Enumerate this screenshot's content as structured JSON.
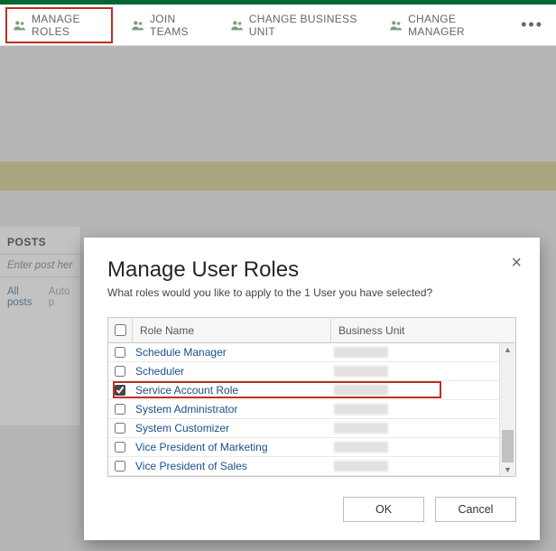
{
  "toolbar": {
    "items": [
      {
        "label": "MANAGE ROLES",
        "highlight": true
      },
      {
        "label": "JOIN TEAMS"
      },
      {
        "label": "CHANGE BUSINESS UNIT"
      },
      {
        "label": "CHANGE MANAGER"
      }
    ]
  },
  "side": {
    "heading": "POSTS",
    "placeholder": "Enter post here",
    "tabs": {
      "all": "All posts",
      "auto": "Auto p"
    }
  },
  "modal": {
    "title": "Manage User Roles",
    "subtitle": "What roles would you like to apply to the 1 User you have selected?",
    "columns": {
      "name": "Role Name",
      "bu": "Business Unit"
    },
    "rows": [
      {
        "name": "Schedule Manager",
        "checked": false
      },
      {
        "name": "Scheduler",
        "checked": false
      },
      {
        "name": "Service Account Role",
        "checked": true
      },
      {
        "name": "System Administrator",
        "checked": false
      },
      {
        "name": "System Customizer",
        "checked": false
      },
      {
        "name": "Vice President of Marketing",
        "checked": false
      },
      {
        "name": "Vice President of Sales",
        "checked": false
      }
    ],
    "highlight_index": 2,
    "buttons": {
      "ok": "OK",
      "cancel": "Cancel"
    }
  }
}
